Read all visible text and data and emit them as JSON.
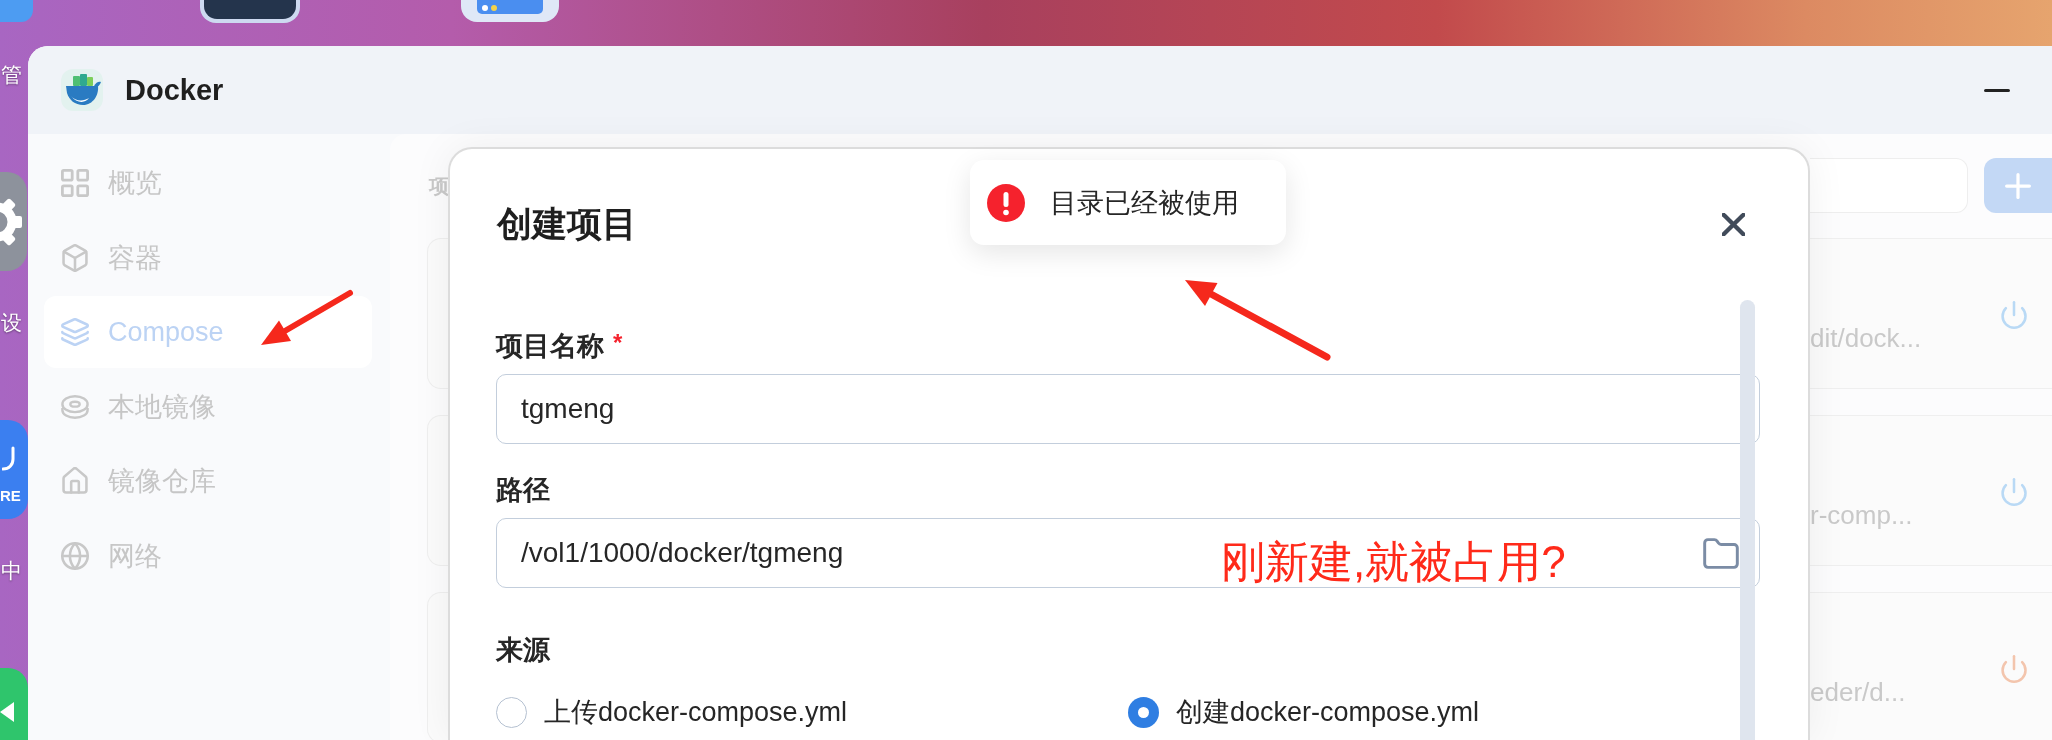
{
  "desktop": {
    "labels": [
      "管",
      "设",
      "中"
    ],
    "badge": "RE"
  },
  "window": {
    "title": "Docker"
  },
  "sidebar": {
    "items": [
      {
        "label": "概览",
        "selected": false
      },
      {
        "label": "容器",
        "selected": false
      },
      {
        "label": "Compose",
        "selected": true
      },
      {
        "label": "本地镜像",
        "selected": false
      },
      {
        "label": "镜像仓库",
        "selected": false
      },
      {
        "label": "网络",
        "selected": false
      }
    ]
  },
  "main": {
    "heading": "项",
    "projects": [
      {
        "path": "dit/dock...",
        "color": "#b9d9f5"
      },
      {
        "path": "r-comp...",
        "color": "#b9d9f5"
      },
      {
        "path": "eder/d...",
        "color": "#f3c5ad"
      }
    ]
  },
  "dialog": {
    "title": "创建项目",
    "fields": [
      {
        "kind": "text",
        "label": "项目名称",
        "required_mark": "*",
        "value": "tgmeng"
      },
      {
        "kind": "path",
        "label": "路径",
        "value": "/vol1/1000/docker/tgmeng"
      }
    ],
    "source": {
      "label": "来源",
      "options": [
        {
          "label": "上传docker-compose.yml",
          "selected": false
        },
        {
          "label": "创建docker-compose.yml",
          "selected": true
        }
      ]
    }
  },
  "toast": {
    "kind": "error",
    "message": "目录已经被使用"
  },
  "annotation": {
    "note": "刚新建,就被占用?"
  }
}
